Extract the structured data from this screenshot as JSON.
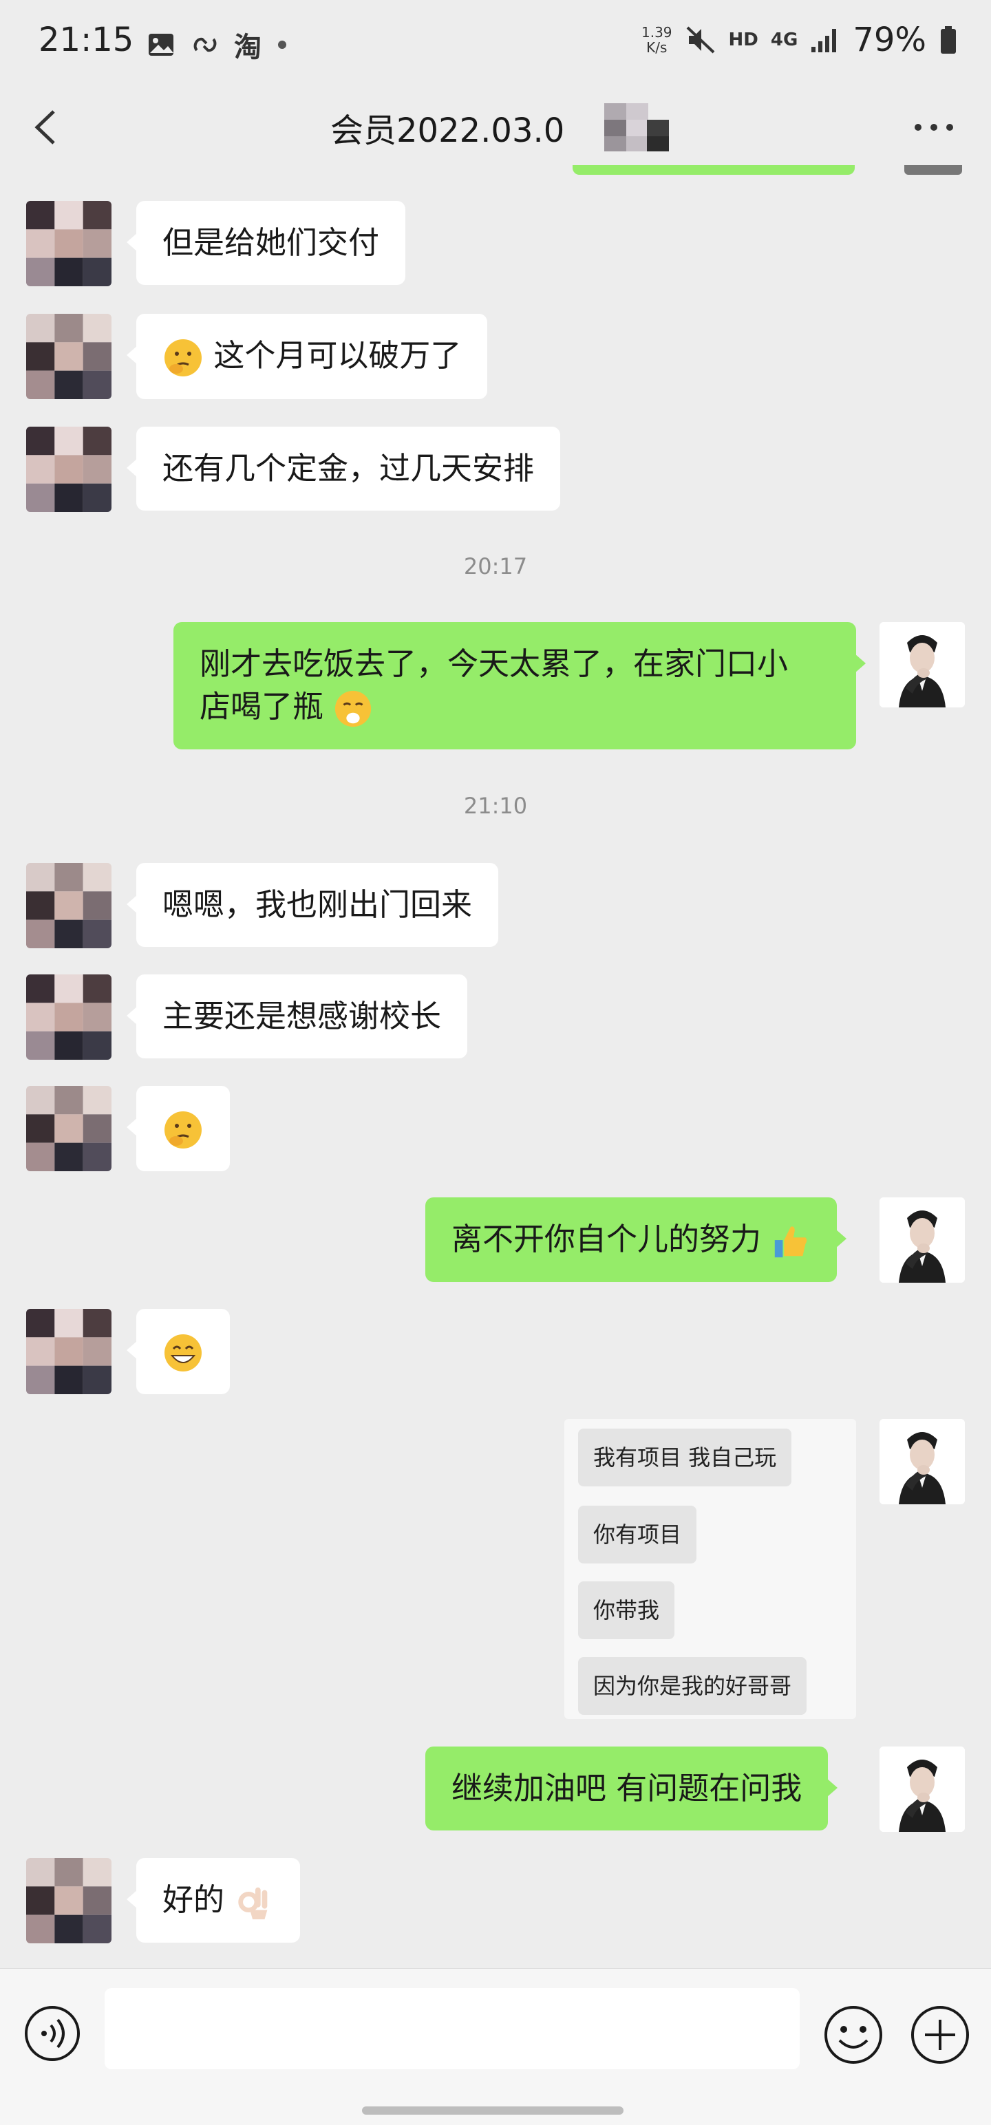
{
  "status_bar": {
    "time": "21:15",
    "taobao_icon_label": "淘",
    "net_speed_value": "1.39",
    "net_speed_unit": "K/s",
    "hd_label": "HD",
    "network_label": "4G",
    "battery": "79%"
  },
  "header": {
    "title": "会员2022.03.0"
  },
  "messages": [
    {
      "side": "left",
      "text": "但是给她们交付"
    },
    {
      "side": "left",
      "text": "这个月可以破万了",
      "emoji": "thinking-face"
    },
    {
      "side": "left",
      "text": "还有几个定金，过几天安排"
    },
    {
      "type": "time",
      "text": "20:17"
    },
    {
      "side": "right",
      "text": "刚才去吃饭去了，今天太累了，在家门口小",
      "text2": "店喝了瓶",
      "emoji": "shushing-face"
    },
    {
      "type": "time",
      "text": "21:10"
    },
    {
      "side": "left",
      "text": "嗯嗯，我也刚出门回来"
    },
    {
      "side": "left",
      "text": "主要还是想感谢校长"
    },
    {
      "side": "left",
      "emoji": "thinking-face"
    },
    {
      "side": "right",
      "text": "离不开你自个儿的努力",
      "emoji": "thumbs-up"
    },
    {
      "side": "left",
      "emoji": "grinning-face"
    },
    {
      "side": "right",
      "type": "image",
      "lines": [
        "我有项目 我自己玩",
        "你有项目",
        "你带我",
        "因为你是我的好哥哥"
      ]
    },
    {
      "side": "right",
      "text": "继续加油吧 有问题在问我"
    },
    {
      "side": "left",
      "text": "好的",
      "emoji": "ok-hand"
    }
  ],
  "input_bar": {
    "placeholder": ""
  },
  "colors": {
    "background": "#ededed",
    "sent_bubble": "#95ec69",
    "received_bubble": "#ffffff",
    "timestamp": "#8c8c8c"
  }
}
